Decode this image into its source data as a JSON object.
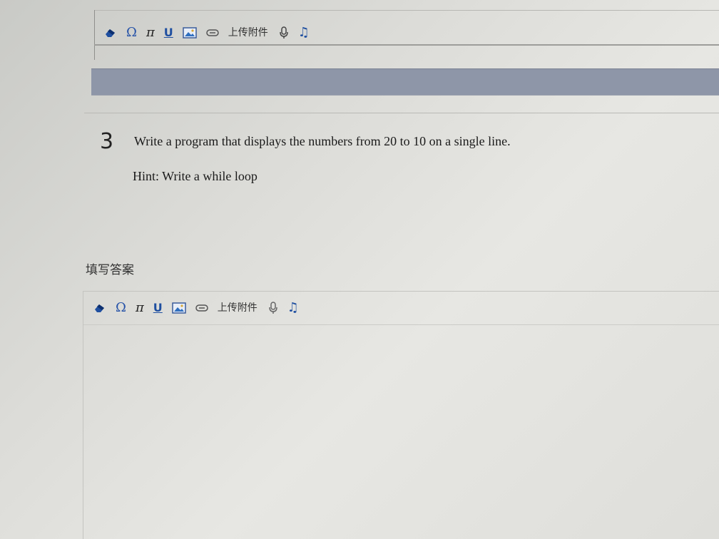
{
  "previous_editor": {
    "toolbar": {
      "omega": "Ω",
      "pi": "π",
      "underline": "U",
      "upload_label": "上传附件",
      "music": "♫"
    }
  },
  "question": {
    "number": "3",
    "text": "Write a program that displays the numbers from 20 to 10 on a single line.",
    "hint": "Hint: Write a while loop"
  },
  "answer": {
    "label": "填写答案",
    "toolbar": {
      "omega": "Ω",
      "pi": "π",
      "underline": "U",
      "upload_label": "上传附件",
      "music": "♫"
    }
  },
  "colors": {
    "toolbar_icon": "#1f4fa0",
    "gray_bar": "#8e96a8"
  }
}
